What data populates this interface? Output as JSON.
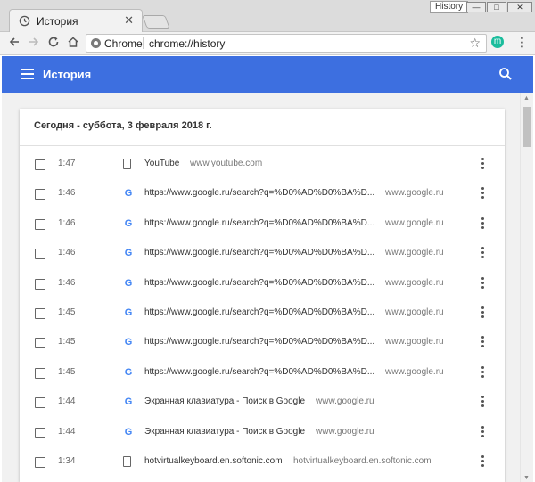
{
  "window": {
    "tab_title": "История",
    "profile_chip": "History",
    "min_symbol": "—",
    "max_symbol": "□",
    "close_symbol": "✕"
  },
  "toolbar": {
    "back_icon": "arrow-left-icon",
    "forward_icon": "arrow-right-icon",
    "reload_icon": "reload-icon",
    "home_icon": "home-icon",
    "omnibox_label": "Chrome",
    "url": "chrome://history",
    "avatar_letter": "m"
  },
  "header": {
    "title": "История",
    "accent_color": "#3d6fe0"
  },
  "history": {
    "date_heading": "Сегодня - суббота, 3 февраля 2018 г.",
    "rows": [
      {
        "time": "1:47",
        "icon": "document-icon",
        "title": "YouTube",
        "domain": "www.youtube.com"
      },
      {
        "time": "1:46",
        "icon": "google-icon",
        "title": "https://www.google.ru/search?q=%D0%AD%D0%BA%D...",
        "domain": "www.google.ru"
      },
      {
        "time": "1:46",
        "icon": "google-icon",
        "title": "https://www.google.ru/search?q=%D0%AD%D0%BA%D...",
        "domain": "www.google.ru"
      },
      {
        "time": "1:46",
        "icon": "google-icon",
        "title": "https://www.google.ru/search?q=%D0%AD%D0%BA%D...",
        "domain": "www.google.ru"
      },
      {
        "time": "1:46",
        "icon": "google-icon",
        "title": "https://www.google.ru/search?q=%D0%AD%D0%BA%D...",
        "domain": "www.google.ru"
      },
      {
        "time": "1:45",
        "icon": "google-icon",
        "title": "https://www.google.ru/search?q=%D0%AD%D0%BA%D...",
        "domain": "www.google.ru"
      },
      {
        "time": "1:45",
        "icon": "google-icon",
        "title": "https://www.google.ru/search?q=%D0%AD%D0%BA%D...",
        "domain": "www.google.ru"
      },
      {
        "time": "1:45",
        "icon": "google-icon",
        "title": "https://www.google.ru/search?q=%D0%AD%D0%BA%D...",
        "domain": "www.google.ru"
      },
      {
        "time": "1:44",
        "icon": "google-icon",
        "title": "Экранная клавиатура - Поиск в Google",
        "domain": "www.google.ru"
      },
      {
        "time": "1:44",
        "icon": "google-icon",
        "title": "Экранная клавиатура - Поиск в Google",
        "domain": "www.google.ru"
      },
      {
        "time": "1:34",
        "icon": "document-icon",
        "title": "hotvirtualkeyboard.en.softonic.com",
        "domain": "hotvirtualkeyboard.en.softonic.com"
      }
    ]
  }
}
